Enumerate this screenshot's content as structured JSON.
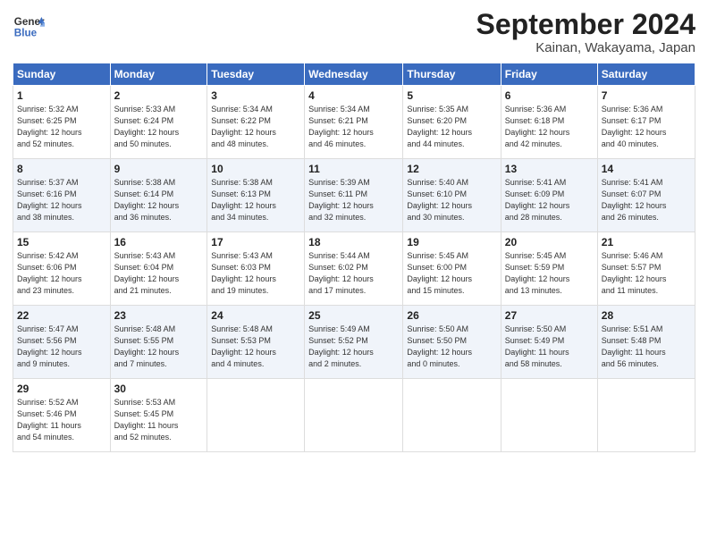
{
  "header": {
    "logo_line1": "General",
    "logo_line2": "Blue",
    "month": "September 2024",
    "location": "Kainan, Wakayama, Japan"
  },
  "weekdays": [
    "Sunday",
    "Monday",
    "Tuesday",
    "Wednesday",
    "Thursday",
    "Friday",
    "Saturday"
  ],
  "weeks": [
    [
      {
        "day": "1",
        "info": "Sunrise: 5:32 AM\nSunset: 6:25 PM\nDaylight: 12 hours\nand 52 minutes."
      },
      {
        "day": "2",
        "info": "Sunrise: 5:33 AM\nSunset: 6:24 PM\nDaylight: 12 hours\nand 50 minutes."
      },
      {
        "day": "3",
        "info": "Sunrise: 5:34 AM\nSunset: 6:22 PM\nDaylight: 12 hours\nand 48 minutes."
      },
      {
        "day": "4",
        "info": "Sunrise: 5:34 AM\nSunset: 6:21 PM\nDaylight: 12 hours\nand 46 minutes."
      },
      {
        "day": "5",
        "info": "Sunrise: 5:35 AM\nSunset: 6:20 PM\nDaylight: 12 hours\nand 44 minutes."
      },
      {
        "day": "6",
        "info": "Sunrise: 5:36 AM\nSunset: 6:18 PM\nDaylight: 12 hours\nand 42 minutes."
      },
      {
        "day": "7",
        "info": "Sunrise: 5:36 AM\nSunset: 6:17 PM\nDaylight: 12 hours\nand 40 minutes."
      }
    ],
    [
      {
        "day": "8",
        "info": "Sunrise: 5:37 AM\nSunset: 6:16 PM\nDaylight: 12 hours\nand 38 minutes."
      },
      {
        "day": "9",
        "info": "Sunrise: 5:38 AM\nSunset: 6:14 PM\nDaylight: 12 hours\nand 36 minutes."
      },
      {
        "day": "10",
        "info": "Sunrise: 5:38 AM\nSunset: 6:13 PM\nDaylight: 12 hours\nand 34 minutes."
      },
      {
        "day": "11",
        "info": "Sunrise: 5:39 AM\nSunset: 6:11 PM\nDaylight: 12 hours\nand 32 minutes."
      },
      {
        "day": "12",
        "info": "Sunrise: 5:40 AM\nSunset: 6:10 PM\nDaylight: 12 hours\nand 30 minutes."
      },
      {
        "day": "13",
        "info": "Sunrise: 5:41 AM\nSunset: 6:09 PM\nDaylight: 12 hours\nand 28 minutes."
      },
      {
        "day": "14",
        "info": "Sunrise: 5:41 AM\nSunset: 6:07 PM\nDaylight: 12 hours\nand 26 minutes."
      }
    ],
    [
      {
        "day": "15",
        "info": "Sunrise: 5:42 AM\nSunset: 6:06 PM\nDaylight: 12 hours\nand 23 minutes."
      },
      {
        "day": "16",
        "info": "Sunrise: 5:43 AM\nSunset: 6:04 PM\nDaylight: 12 hours\nand 21 minutes."
      },
      {
        "day": "17",
        "info": "Sunrise: 5:43 AM\nSunset: 6:03 PM\nDaylight: 12 hours\nand 19 minutes."
      },
      {
        "day": "18",
        "info": "Sunrise: 5:44 AM\nSunset: 6:02 PM\nDaylight: 12 hours\nand 17 minutes."
      },
      {
        "day": "19",
        "info": "Sunrise: 5:45 AM\nSunset: 6:00 PM\nDaylight: 12 hours\nand 15 minutes."
      },
      {
        "day": "20",
        "info": "Sunrise: 5:45 AM\nSunset: 5:59 PM\nDaylight: 12 hours\nand 13 minutes."
      },
      {
        "day": "21",
        "info": "Sunrise: 5:46 AM\nSunset: 5:57 PM\nDaylight: 12 hours\nand 11 minutes."
      }
    ],
    [
      {
        "day": "22",
        "info": "Sunrise: 5:47 AM\nSunset: 5:56 PM\nDaylight: 12 hours\nand 9 minutes."
      },
      {
        "day": "23",
        "info": "Sunrise: 5:48 AM\nSunset: 5:55 PM\nDaylight: 12 hours\nand 7 minutes."
      },
      {
        "day": "24",
        "info": "Sunrise: 5:48 AM\nSunset: 5:53 PM\nDaylight: 12 hours\nand 4 minutes."
      },
      {
        "day": "25",
        "info": "Sunrise: 5:49 AM\nSunset: 5:52 PM\nDaylight: 12 hours\nand 2 minutes."
      },
      {
        "day": "26",
        "info": "Sunrise: 5:50 AM\nSunset: 5:50 PM\nDaylight: 12 hours\nand 0 minutes."
      },
      {
        "day": "27",
        "info": "Sunrise: 5:50 AM\nSunset: 5:49 PM\nDaylight: 11 hours\nand 58 minutes."
      },
      {
        "day": "28",
        "info": "Sunrise: 5:51 AM\nSunset: 5:48 PM\nDaylight: 11 hours\nand 56 minutes."
      }
    ],
    [
      {
        "day": "29",
        "info": "Sunrise: 5:52 AM\nSunset: 5:46 PM\nDaylight: 11 hours\nand 54 minutes."
      },
      {
        "day": "30",
        "info": "Sunrise: 5:53 AM\nSunset: 5:45 PM\nDaylight: 11 hours\nand 52 minutes."
      },
      null,
      null,
      null,
      null,
      null
    ]
  ]
}
